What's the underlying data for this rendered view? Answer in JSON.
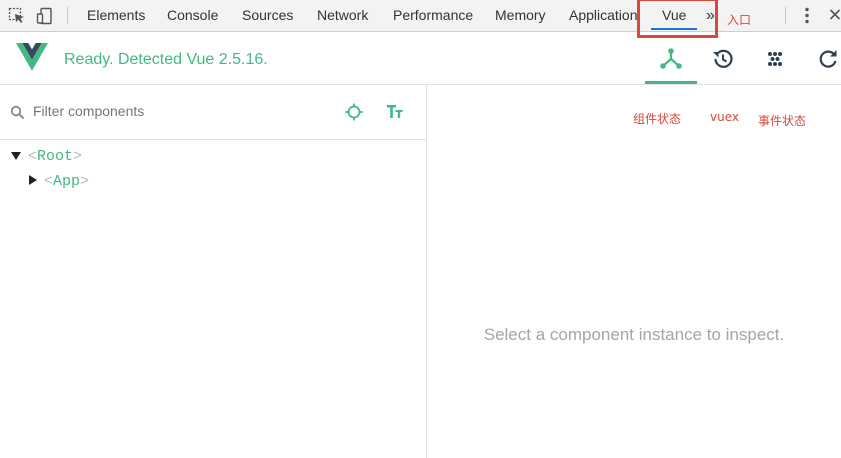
{
  "devtools_tabs": {
    "elements": "Elements",
    "console": "Console",
    "sources": "Sources",
    "network": "Network",
    "performance": "Performance",
    "memory": "Memory",
    "application": "Application",
    "vue": "Vue",
    "more": "»"
  },
  "annotations": {
    "entry": "入口",
    "component_state": "组件状态",
    "vuex": "vuex",
    "event_state": "事件状态"
  },
  "vue_header": {
    "status": "Ready. Detected Vue 2.5.16."
  },
  "filter": {
    "placeholder": "Filter components"
  },
  "tree": {
    "root": {
      "open": "<",
      "name": "Root",
      "close": ">"
    },
    "app": {
      "open": "<",
      "name": "App",
      "close": ">"
    }
  },
  "inspector": {
    "empty_message": "Select a component instance to inspect."
  },
  "colors": {
    "vue_green": "#42b983",
    "vue_dark": "#35495e",
    "annotation_red": "#d9483b",
    "tab_blue": "#1a73e8"
  },
  "icons": {
    "inspect": "cursor-select-icon",
    "device": "device-toolbar-icon",
    "menu": "kebab-menu-icon",
    "close": "close-icon",
    "components": "component-tree-icon",
    "history": "history-icon",
    "events": "events-grid-icon",
    "refresh": "refresh-icon",
    "search": "search-icon",
    "target": "select-target-icon",
    "text": "text-format-icon"
  }
}
